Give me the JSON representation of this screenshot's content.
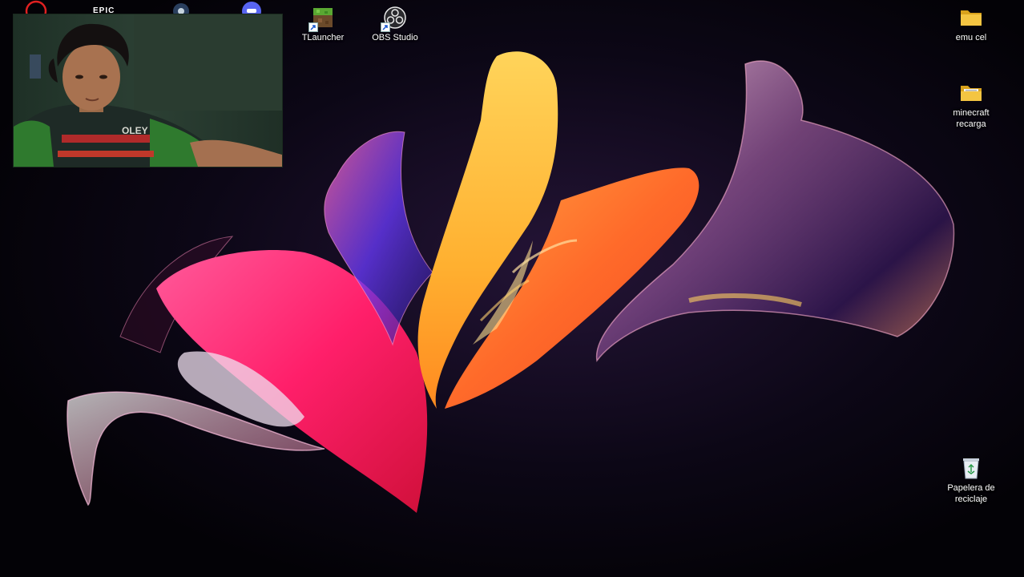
{
  "desktop": {
    "icons_top": [
      {
        "label": "TLauncher",
        "icon": "tlauncher-icon"
      },
      {
        "label": "OBS Studio",
        "icon": "obs-studio-icon"
      }
    ],
    "partial_icons": [
      {
        "text": "EPIC",
        "icon": "epic-games-icon"
      }
    ],
    "icons_right": [
      {
        "label": "emu cel",
        "icon": "folder-icon"
      },
      {
        "label": "minecraft\nrecarga",
        "icon": "folder-icon"
      },
      {
        "label": "Papelera de\nreciclaje",
        "icon": "recycle-bin-icon"
      }
    ]
  },
  "webcam": {
    "shirt_text": "OLEY"
  },
  "colors": {
    "background": "#06040c",
    "folder": "#f4c542",
    "petal_pink": "#ff2a78",
    "petal_orange": "#ff7a2a",
    "petal_yellow": "#ffc23a"
  }
}
